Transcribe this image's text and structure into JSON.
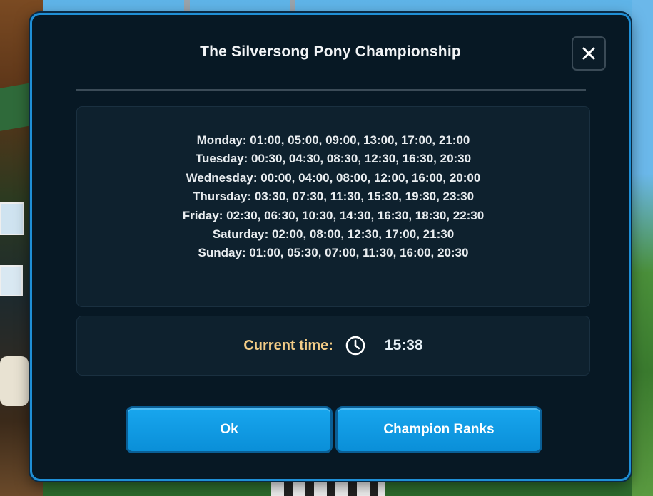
{
  "dialog": {
    "title": "The Silversong Pony Championship",
    "close_icon": "close-icon"
  },
  "schedule": [
    "Monday: 01:00, 05:00, 09:00, 13:00, 17:00, 21:00",
    "Tuesday: 00:30, 04:30, 08:30, 12:30, 16:30, 20:30",
    "Wednesday: 00:00, 04:00, 08:00, 12:00, 16:00, 20:00",
    "Thursday: 03:30, 07:30, 11:30, 15:30, 19:30, 23:30",
    "Friday: 02:30, 06:30, 10:30, 14:30, 16:30, 18:30, 22:30",
    "Saturday: 02:00, 08:00, 12:30, 17:00, 21:30",
    "Sunday: 01:00, 05:30, 07:00, 11:30, 16:00, 20:30"
  ],
  "current_time": {
    "label": "Current time:",
    "icon": "clock-icon",
    "value": "15:38"
  },
  "buttons": {
    "ok_label": "Ok",
    "ranks_label": "Champion Ranks"
  },
  "colors": {
    "dialog_bg": "#071824",
    "border_accent": "#1f8fd6",
    "button_blue": "#0a8fd8",
    "time_label": "#f3cc86"
  }
}
